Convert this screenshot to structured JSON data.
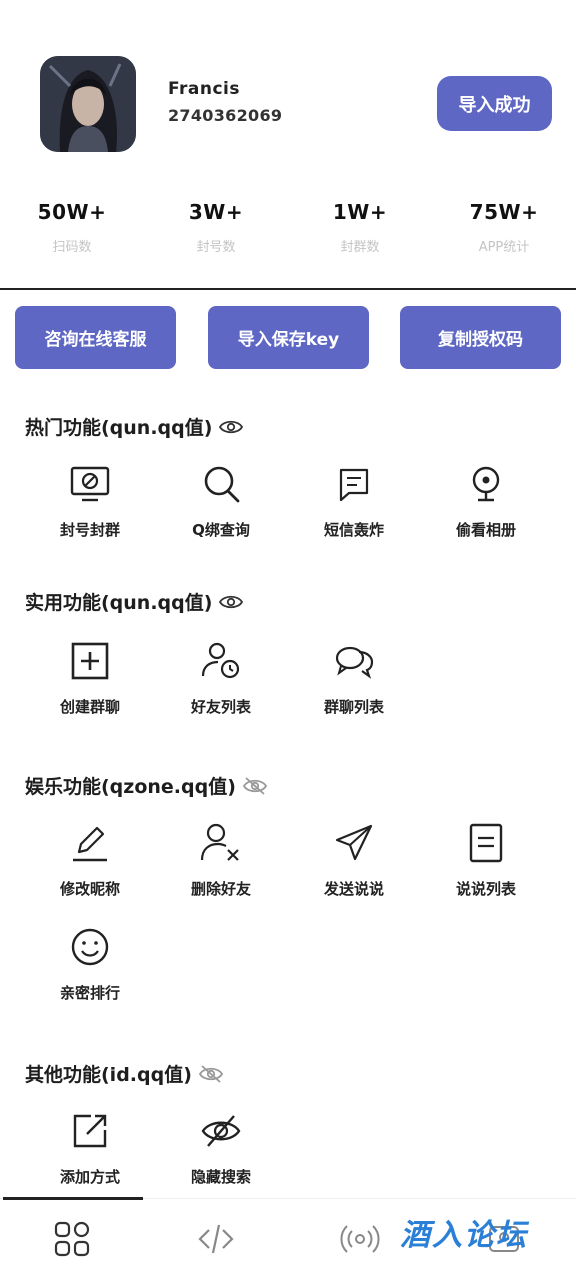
{
  "profile": {
    "name": "Francis",
    "uid": "2740362069",
    "import_status_label": "导入成功"
  },
  "stats": [
    {
      "value": "50W+",
      "label": "扫码数"
    },
    {
      "value": "3W+",
      "label": "封号数"
    },
    {
      "value": "1W+",
      "label": "封群数"
    },
    {
      "value": "75W+",
      "label": "APP统计"
    }
  ],
  "actions": [
    {
      "label": "咨询在线客服"
    },
    {
      "label": "导入保存key"
    },
    {
      "label": "复制授权码"
    }
  ],
  "sections": [
    {
      "title": "热门功能(qun.qq值)",
      "eye": "eye-icon",
      "items": [
        {
          "label": "封号封群",
          "icon": "monitor-ban-icon"
        },
        {
          "label": "Q绑查询",
          "icon": "search-icon"
        },
        {
          "label": "短信轰炸",
          "icon": "message-icon"
        },
        {
          "label": "偷看相册",
          "icon": "webcam-icon"
        }
      ]
    },
    {
      "title": "实用功能(qun.qq值)",
      "eye": "eye-icon",
      "items": [
        {
          "label": "创建群聊",
          "icon": "add-square-icon"
        },
        {
          "label": "好友列表",
          "icon": "user-clock-icon"
        },
        {
          "label": "群聊列表",
          "icon": "chat-bubbles-icon"
        }
      ]
    },
    {
      "title": "娱乐功能(qzone.qq值)",
      "eye": "eye-off-icon",
      "items": [
        {
          "label": "修改昵称",
          "icon": "pen-icon"
        },
        {
          "label": "删除好友",
          "icon": "user-remove-icon"
        },
        {
          "label": "发送说说",
          "icon": "send-icon"
        },
        {
          "label": "说说列表",
          "icon": "note-icon"
        },
        {
          "label": "亲密排行",
          "icon": "smile-icon"
        }
      ]
    },
    {
      "title": "其他功能(id.qq值)",
      "eye": "eye-off-icon",
      "items": [
        {
          "label": "添加方式",
          "icon": "external-link-icon"
        },
        {
          "label": "隐藏搜索",
          "icon": "eye-off-icon"
        }
      ]
    }
  ],
  "bottom_nav": [
    {
      "icon": "grid-icon",
      "active": true
    },
    {
      "icon": "code-icon",
      "active": false
    },
    {
      "icon": "broadcast-icon",
      "active": false
    },
    {
      "icon": "profile-icon",
      "active": false
    }
  ],
  "watermark": "酒入论坛",
  "colors": {
    "accent": "#5f67c4",
    "stat_label": "#c4c4c4",
    "watermark": "#2a7fd6"
  }
}
